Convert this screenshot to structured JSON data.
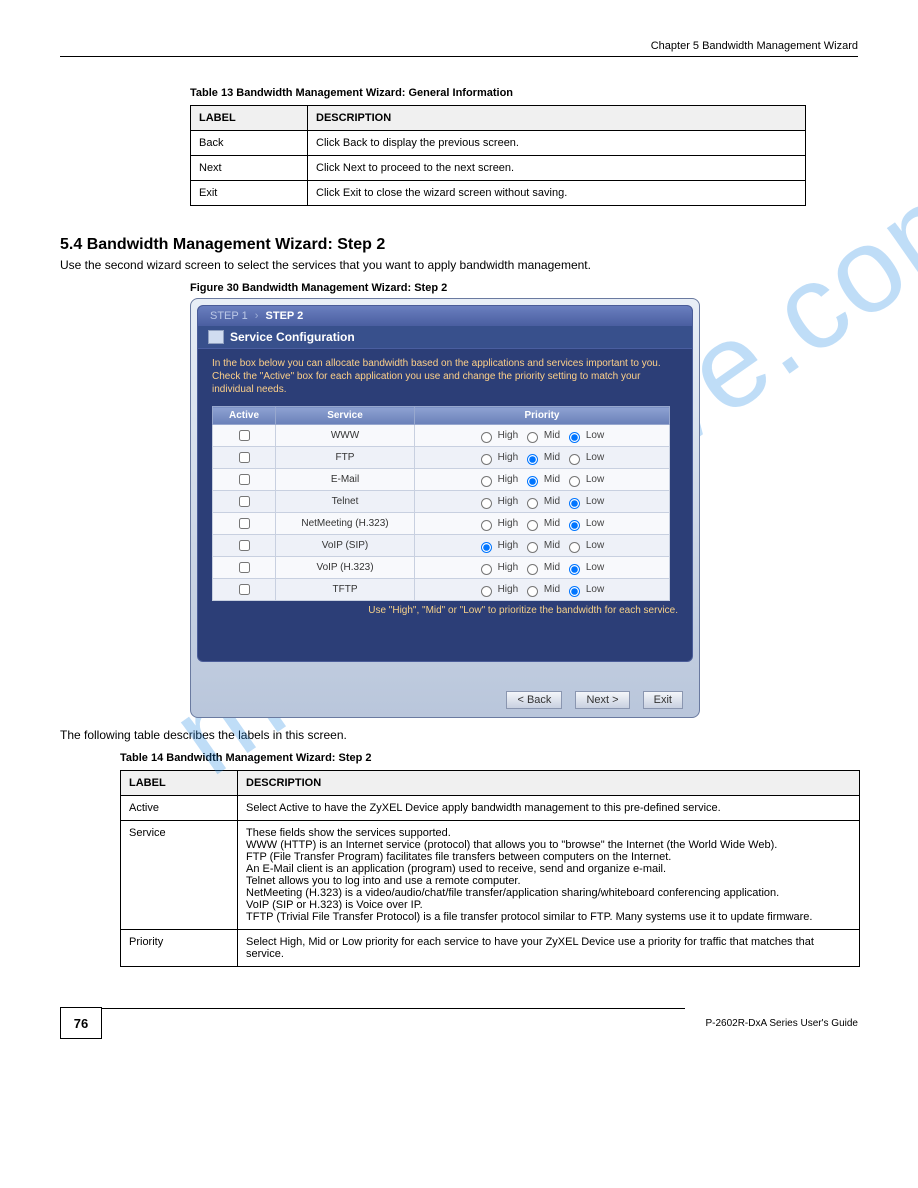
{
  "header": {
    "chapter": "Chapter 5 Bandwidth Management Wizard"
  },
  "table1": {
    "caption": "Table 13   Bandwidth Management Wizard: General Information",
    "columns": [
      "LABEL",
      "DESCRIPTION"
    ],
    "rows": [
      {
        "label": "Back",
        "desc": "Click Back to display the previous screen."
      },
      {
        "label": "Next",
        "desc": "Click Next to proceed to the next screen."
      },
      {
        "label": "Exit",
        "desc": "Click Exit to close the wizard screen without saving."
      }
    ]
  },
  "heading2": "5.4  Bandwidth Management Wizard: Step 2",
  "intro": "Use the second wizard screen to select the services that you want to apply bandwidth management.",
  "figureCaption": "Figure 30   Bandwidth Management Wizard: Step 2",
  "screenshot": {
    "steps": {
      "step1": "STEP 1",
      "step2": "STEP 2"
    },
    "sectionTitle": "Service Configuration",
    "description": "In the box below you can allocate bandwidth based on the applications and services important to you. Check the \"Active\" box for each application you use and change the priority setting to match your individual needs.",
    "columns": [
      "Active",
      "Service",
      "Priority"
    ],
    "priLabels": {
      "high": "High",
      "mid": "Mid",
      "low": "Low"
    },
    "services": [
      {
        "name": "WWW",
        "priority": "low"
      },
      {
        "name": "FTP",
        "priority": "mid"
      },
      {
        "name": "E-Mail",
        "priority": "mid"
      },
      {
        "name": "Telnet",
        "priority": "low"
      },
      {
        "name": "NetMeeting (H.323)",
        "priority": "low"
      },
      {
        "name": "VoIP (SIP)",
        "priority": "high"
      },
      {
        "name": "VoIP (H.323)",
        "priority": "low"
      },
      {
        "name": "TFTP",
        "priority": "low"
      }
    ],
    "hint": "Use \"High\", \"Mid\" or \"Low\" to prioritize the bandwidth for each service.",
    "buttons": {
      "back": "< Back",
      "next": "Next >",
      "exit": "Exit"
    }
  },
  "table2": {
    "preText": "The following table describes the labels in this screen.",
    "caption": "Table 14   Bandwidth Management Wizard: Step 2",
    "columns": [
      "LABEL",
      "DESCRIPTION"
    ],
    "rows": [
      {
        "label": "Active",
        "desc": "Select Active to have the ZyXEL Device apply bandwidth management to this pre-defined service."
      },
      {
        "label": "Service",
        "desc": "These fields show the services supported.\nWWW (HTTP) is an Internet service (protocol) that allows you to \"browse\" the Internet (the World Wide Web).\nFTP (File Transfer Program) facilitates file transfers between computers on the Internet.\nAn E-Mail client is an application (program) used to receive, send and organize e-mail.\nTelnet allows you to log into and use a remote computer.\nNetMeeting (H.323) is a video/audio/chat/file transfer/application sharing/whiteboard conferencing application.\nVoIP (SIP or H.323) is Voice over IP.\nTFTP (Trivial File Transfer Protocol) is a file transfer protocol similar to FTP. Many systems use it to update firmware."
      },
      {
        "label": "Priority",
        "desc": "Select High, Mid or Low priority for each service to have your ZyXEL Device use a priority for traffic that matches that service."
      }
    ]
  },
  "footer": {
    "pageNum": "76",
    "guide": "P-2602R-DxA Series User's Guide"
  },
  "watermark": "manualshive.com"
}
